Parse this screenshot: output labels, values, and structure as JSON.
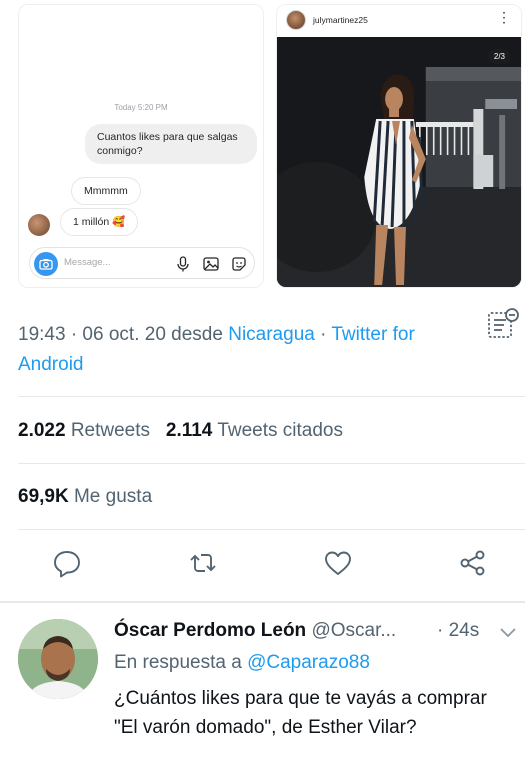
{
  "dm_screenshot": {
    "time_label": "Today 5:20 PM",
    "messages": [
      "Cuantos likes para que salgas conmigo?",
      "Mmmmm",
      "1 millón 🥰"
    ],
    "input_placeholder": "Message..."
  },
  "ig_post": {
    "username": "julymartinez25",
    "counter": "2/3",
    "more": "⋮"
  },
  "tweet_meta": {
    "time_date": "19:43 · 06 oct. 20 desde ",
    "location": "Nicaragua",
    "separator": " · ",
    "source": "Twitter for Android"
  },
  "stats": {
    "retweets_count": "2.022",
    "retweets_label": "Retweets",
    "quotes_count": "2.114",
    "quotes_label": "Tweets citados",
    "likes_count": "69,9K",
    "likes_label": "Me gusta"
  },
  "actions": [
    "reply-icon",
    "retweet-icon",
    "like-icon",
    "share-icon"
  ],
  "reply": {
    "name": "Óscar Perdomo León",
    "handle": "@Oscar...",
    "time": "· 24s",
    "replying_prefix": "En respuesta a ",
    "replying_to": "@Caparazo88",
    "text": "¿Cuántos likes para que te vayás a comprar \"El varón domado\", de Esther Vilar?"
  },
  "colors": {
    "accent": "#1d9bf0",
    "secondary_text": "#536471",
    "primary_text": "#0f1419"
  }
}
